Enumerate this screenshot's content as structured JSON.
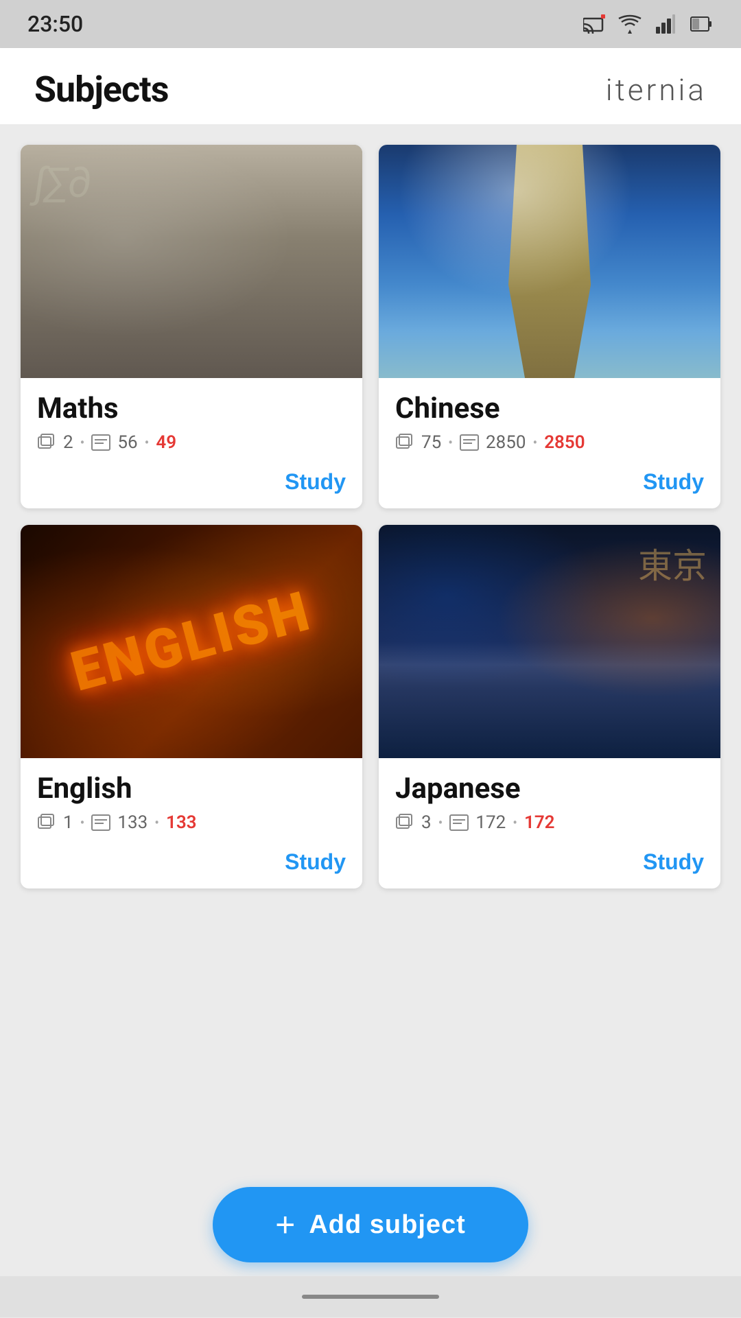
{
  "statusBar": {
    "time": "23:50",
    "icons": [
      "cast",
      "wifi",
      "signal",
      "battery"
    ]
  },
  "header": {
    "title": "Subjects",
    "brand": "iternia"
  },
  "subjects": [
    {
      "id": "maths",
      "name": "Maths",
      "decks": "2",
      "cards": "56",
      "overdue": "49",
      "studyLabel": "Study",
      "imageType": "maths"
    },
    {
      "id": "chinese",
      "name": "Chinese",
      "decks": "75",
      "cards": "2850",
      "overdue": "2850",
      "studyLabel": "Study",
      "imageType": "chinese"
    },
    {
      "id": "english",
      "name": "English",
      "decks": "1",
      "cards": "133",
      "overdue": "133",
      "studyLabel": "Study",
      "imageType": "english"
    },
    {
      "id": "japanese",
      "name": "Japanese",
      "decks": "3",
      "cards": "172",
      "overdue": "172",
      "studyLabel": "Study",
      "imageType": "japanese"
    }
  ],
  "addButton": {
    "label": "Add subject",
    "plusIcon": "+"
  }
}
